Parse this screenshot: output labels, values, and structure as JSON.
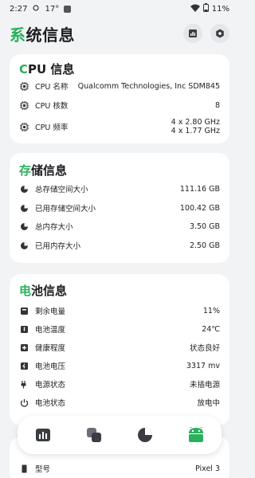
{
  "status": {
    "time": "2:27",
    "temp": "17°",
    "battery": "11%"
  },
  "app": {
    "title_first": "系",
    "title_rest": "统信息"
  },
  "cpu": {
    "title_first": "C",
    "title_rest": "PU 信息",
    "rows": [
      {
        "label": "CPU 名称",
        "value": "Qualcomm Technologies, Inc SDM845"
      },
      {
        "label": "CPU 核数",
        "value": "8"
      },
      {
        "label": "CPU 频率",
        "value_line1": "4 x 2.80 GHz",
        "value_line2": "4 x 1.77 GHz"
      }
    ]
  },
  "storage": {
    "title_first": "存",
    "title_rest": "储信息",
    "rows": [
      {
        "label": "总存储空间大小",
        "value": "111.16 GB"
      },
      {
        "label": "已用存储空间大小",
        "value": "100.42 GB"
      },
      {
        "label": "总内存大小",
        "value": "3.50 GB"
      },
      {
        "label": "已用内存大小",
        "value": "2.50 GB"
      }
    ]
  },
  "battery": {
    "title_first": "电",
    "title_rest": "池信息",
    "rows": [
      {
        "label": "剩余电量",
        "value": "11%"
      },
      {
        "label": "电池温度",
        "value": "24℃"
      },
      {
        "label": "健康程度",
        "value": "状态良好"
      },
      {
        "label": "电池电压",
        "value": "3317 mv"
      },
      {
        "label": "电源状态",
        "value": "未插电源"
      },
      {
        "label": "电池状态",
        "value": "放电中"
      }
    ]
  },
  "peek": {
    "label": "型号",
    "value": "Pixel 3"
  },
  "colors": {
    "accent": "#2bb05d",
    "nav_active": "#2bb05d",
    "icon_dark": "#3a3d42"
  },
  "nav": {
    "items": [
      "device-info",
      "cpu-info",
      "storage-info",
      "system-info"
    ],
    "active": "system-info"
  }
}
